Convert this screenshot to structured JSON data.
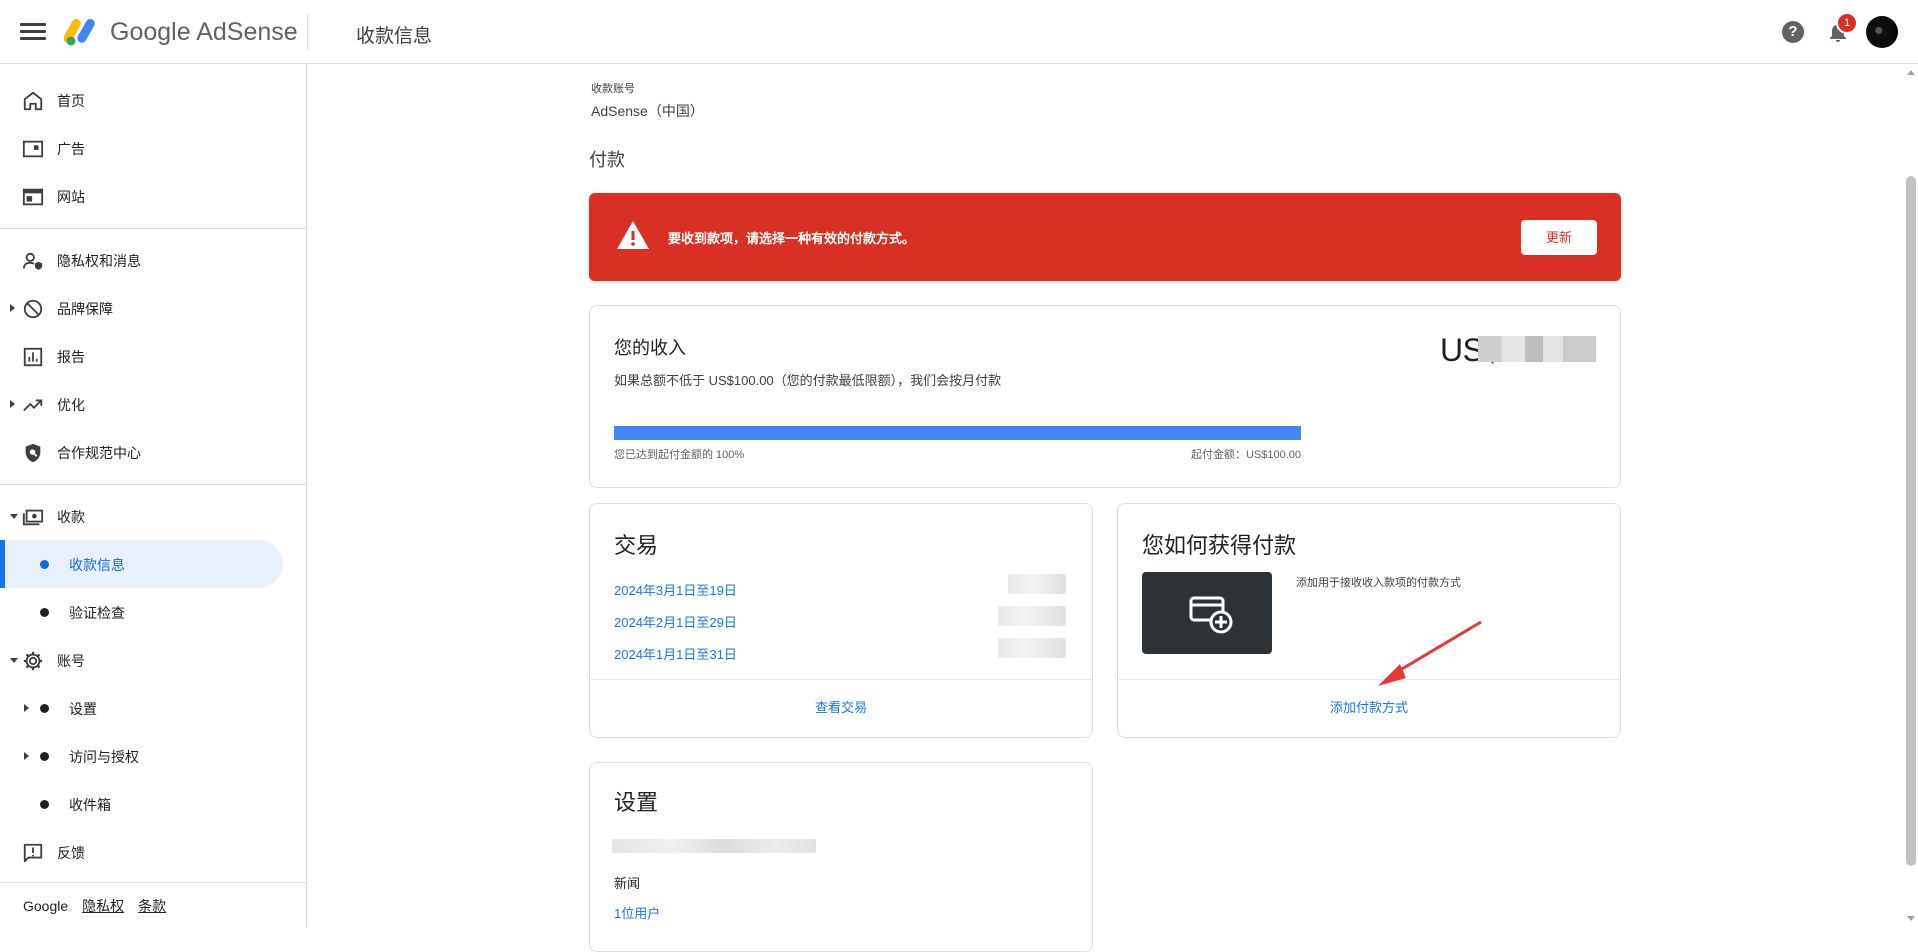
{
  "header": {
    "brand_google": "Google",
    "brand_adsense": "AdSense",
    "page_title": "收款信息",
    "help_icon": "?",
    "notification_count": "1"
  },
  "sidebar": {
    "items": [
      {
        "label": "首页",
        "icon": "home-icon"
      },
      {
        "label": "广告",
        "icon": "ads-icon"
      },
      {
        "label": "网站",
        "icon": "sites-icon"
      },
      {
        "label": "隐私权和消息",
        "icon": "privacy-icon"
      },
      {
        "label": "品牌保障",
        "icon": "block-icon"
      },
      {
        "label": "报告",
        "icon": "report-icon"
      },
      {
        "label": "优化",
        "icon": "trending-icon"
      },
      {
        "label": "合作规范中心",
        "icon": "policy-icon"
      },
      {
        "label": "收款",
        "icon": "payments-icon"
      },
      {
        "label": "收款信息"
      },
      {
        "label": "验证检查"
      },
      {
        "label": "账号",
        "icon": "gear-icon"
      },
      {
        "label": "设置"
      },
      {
        "label": "访问与授权"
      },
      {
        "label": "收件箱"
      },
      {
        "label": "反馈",
        "icon": "feedback-icon"
      }
    ],
    "footer": {
      "google": "Google",
      "privacy": "隐私权",
      "terms": "条款"
    }
  },
  "account": {
    "label": "收款账号",
    "value": "AdSense（中国）"
  },
  "payments_title": "付款",
  "alert": {
    "message": "要收到款项，请选择一种有效的付款方式。",
    "button": "更新",
    "color": "#d93025"
  },
  "earnings": {
    "title": "您的收入",
    "description": "如果总额不低于 US$100.00（您的付款最低限额），我们会按月付款",
    "amount_prefix": "US$",
    "progress_left": "您已达到起付金额的 100%",
    "progress_right": "起付金额：US$100.00",
    "progress_percent": 100
  },
  "transactions": {
    "title": "交易",
    "rows": [
      "2024年3月1日至19日",
      "2024年2月1日至29日",
      "2024年1月1日至31日"
    ],
    "footer": "查看交易"
  },
  "how_paid": {
    "title": "您如何获得付款",
    "description": "添加用于接收收入款项的付款方式",
    "footer": "添加付款方式"
  },
  "settings": {
    "title": "设置",
    "news": "新闻",
    "users": "1位用户"
  }
}
